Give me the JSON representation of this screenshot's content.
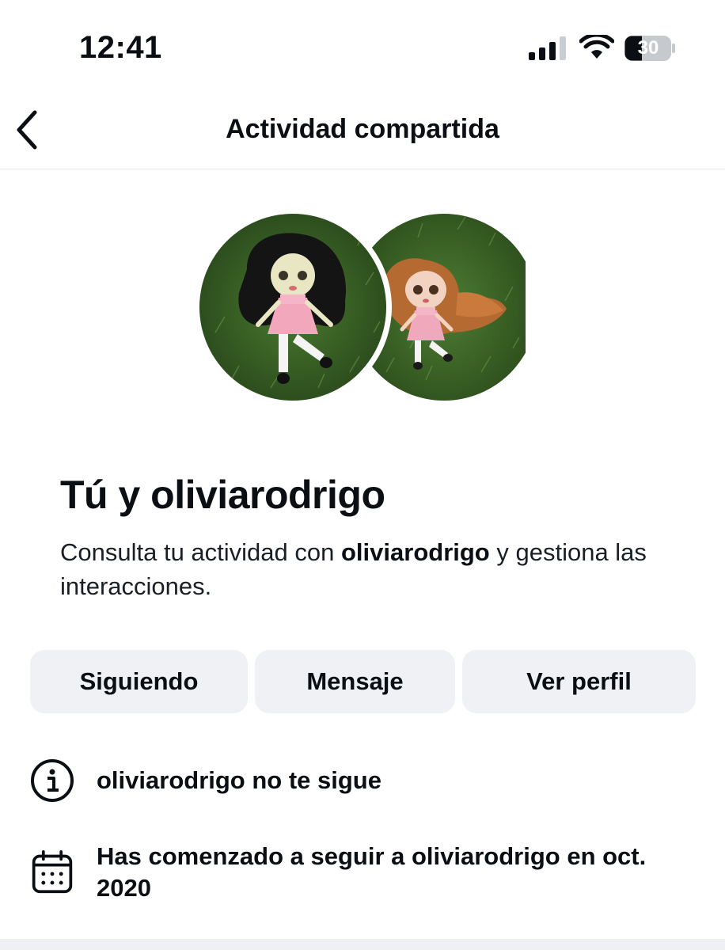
{
  "status_bar": {
    "time": "12:41",
    "battery_level": "30",
    "icons": [
      "cellular-signal-icon",
      "wifi-icon",
      "battery-icon"
    ]
  },
  "nav": {
    "title": "Actividad compartida",
    "back_icon": "chevron-left-icon"
  },
  "avatars": {
    "left": "doll-with-black-hair-photo",
    "right": "doll-with-auburn-hair-photo"
  },
  "header": {
    "title": "Tú y oliviarodrigo",
    "description_before": "Consulta tu actividad con ",
    "description_username": "oliviarodrigo",
    "description_after": " y gestiona las interacciones."
  },
  "actions": {
    "following_label": "Siguiendo",
    "message_label": "Mensaje",
    "profile_label": "Ver perfil"
  },
  "info": {
    "follow_status": "oliviarodrigo no te sigue",
    "follow_status_icon": "info-icon",
    "follow_since": "Has comenzado a seguir a oliviarodrigo en oct. 2020",
    "follow_since_icon": "calendar-icon"
  },
  "colors": {
    "text": "#0b0f14",
    "button_bg": "#eff1f4",
    "divider": "#e6e8eb",
    "grass": "#3f6b2a"
  }
}
